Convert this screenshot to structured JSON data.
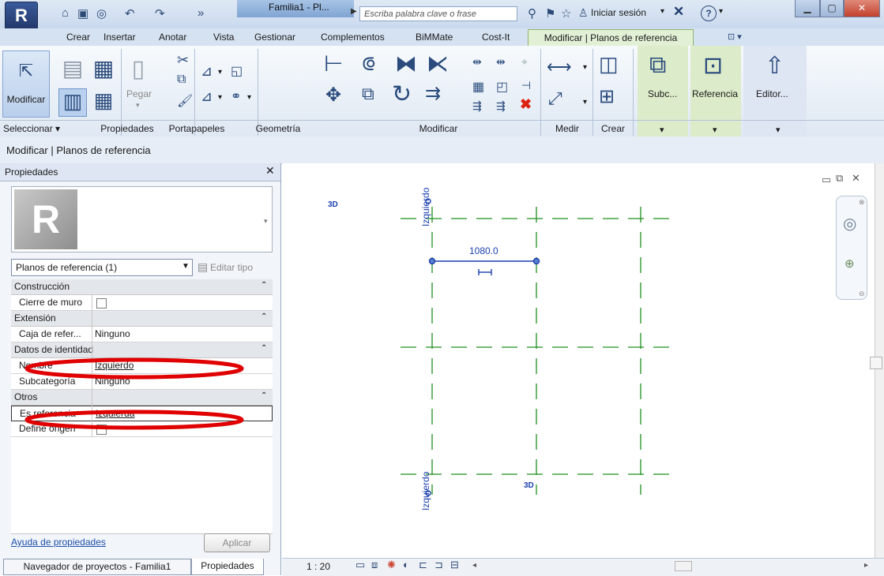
{
  "titlebar": {
    "app_logo": "R",
    "window_title": "Familia1 - Pl...",
    "search_placeholder": "Escriba palabra clave o frase",
    "signin_label": "Iniciar sesión",
    "help_label": "?"
  },
  "ribbon_tabs": [
    "Crear",
    "Insertar",
    "Anotar",
    "Vista",
    "Gestionar",
    "Complementos",
    "BiMMate",
    "Cost-It",
    "Modificar | Planos de referencia"
  ],
  "ribbon": {
    "modify_label": "Modificar",
    "paste_label": "Pegar",
    "subc_label": "Subc...",
    "referencia_label": "Referencia",
    "editor_label": "Editor...",
    "panels": [
      "Seleccionar ▾",
      "Propiedades",
      "Portapapeles",
      "Geometría",
      "Modificar",
      "Medir",
      "Crear"
    ]
  },
  "context_bar": {
    "label": "Modificar | Planos de referencia"
  },
  "properties": {
    "header": "Propiedades",
    "type_selector": "Planos de referencia (1)",
    "edit_type": "Editar tipo",
    "sections": {
      "construccion": "Construcción",
      "extension": "Extensión",
      "identidad": "Datos de identidad",
      "otros": "Otros"
    },
    "rows": {
      "cierre": "Cierre de muro",
      "caja": "Caja de refer...",
      "caja_val": "Ninguno",
      "nombre": "Nombre",
      "nombre_val": "Izquierdo",
      "subcat": "Subcategoría",
      "subcat_val": "Ninguno",
      "esref": "Es referencia",
      "esref_val": "Izquierda",
      "origen": "Define origen"
    },
    "help_link": "Ayuda de propiedades",
    "apply_label": "Aplicar"
  },
  "bottom_tabs": {
    "browser": "Navegador de proyectos - Familia1",
    "props": "Propiedades"
  },
  "status": {
    "scale": "1 : 20"
  },
  "drawing": {
    "label_3d_top": "3D",
    "label_3d_bottom": "3D",
    "label_izq_top": "Izquierdo",
    "label_izq_bottom": "Izquierdo",
    "dimension": "1080.0"
  },
  "colors": {
    "ref_plane": "#1f8f1f",
    "annotation": "#1a3fae",
    "highlight": "#e00000"
  }
}
